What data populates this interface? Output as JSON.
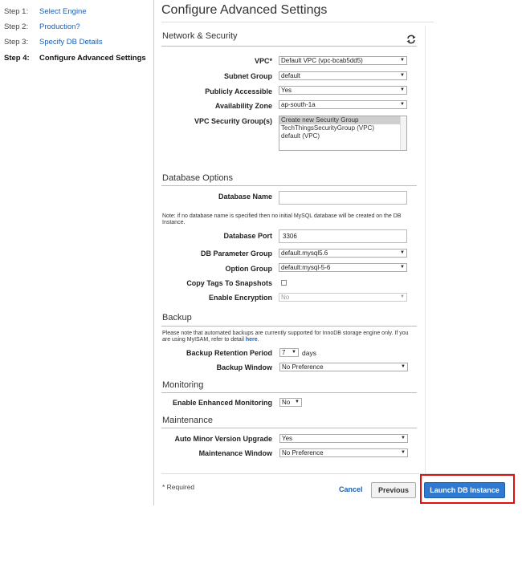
{
  "steps": [
    {
      "num": "Step 1:",
      "label": "Select Engine"
    },
    {
      "num": "Step 2:",
      "label": "Production?"
    },
    {
      "num": "Step 3:",
      "label": "Specify DB Details"
    },
    {
      "num": "Step 4:",
      "label": "Configure Advanced Settings"
    }
  ],
  "page_title": "Configure Advanced Settings",
  "network": {
    "title": "Network & Security",
    "vpc_label": "VPC*",
    "vpc_value": "Default VPC (vpc-bcab5dd5)",
    "subnet_label": "Subnet Group",
    "subnet_value": "default",
    "public_label": "Publicly Accessible",
    "public_value": "Yes",
    "az_label": "Availability Zone",
    "az_value": "ap-south-1a",
    "sg_label": "VPC Security Group(s)",
    "sg_options": [
      "Create new Security Group",
      "TechThingsSecurityGroup (VPC)",
      "default (VPC)"
    ]
  },
  "database": {
    "title": "Database Options",
    "name_label": "Database Name",
    "name_value": "",
    "note": "Note: if no database name is specified then no initial MySQL database will be created on the DB Instance.",
    "port_label": "Database Port",
    "port_value": "3306",
    "param_label": "DB Parameter Group",
    "param_value": "default.mysql5.6",
    "option_label": "Option Group",
    "option_value": "default:mysql-5-6",
    "copy_tags_label": "Copy Tags To Snapshots",
    "encryption_label": "Enable Encryption",
    "encryption_value": "No"
  },
  "backup": {
    "title": "Backup",
    "note": "Please note that automated backups are currently supported for InnoDB storage engine only. If you are using MyISAM, refer to detail ",
    "note_link": "here",
    "retention_label": "Backup Retention Period",
    "retention_value": "7",
    "days": "days",
    "window_label": "Backup Window",
    "window_value": "No Preference"
  },
  "monitoring": {
    "title": "Monitoring",
    "enhanced_label": "Enable Enhanced Monitoring",
    "enhanced_value": "No"
  },
  "maintenance": {
    "title": "Maintenance",
    "minor_label": "Auto Minor Version Upgrade",
    "minor_value": "Yes",
    "window_label": "Maintenance Window",
    "window_value": "No Preference"
  },
  "footer": {
    "required": "* Required",
    "cancel": "Cancel",
    "previous": "Previous",
    "launch": "Launch DB Instance"
  },
  "colors": {
    "accent": "#2f79d0",
    "link": "#1a5fb4",
    "highlight": "#e01010"
  }
}
